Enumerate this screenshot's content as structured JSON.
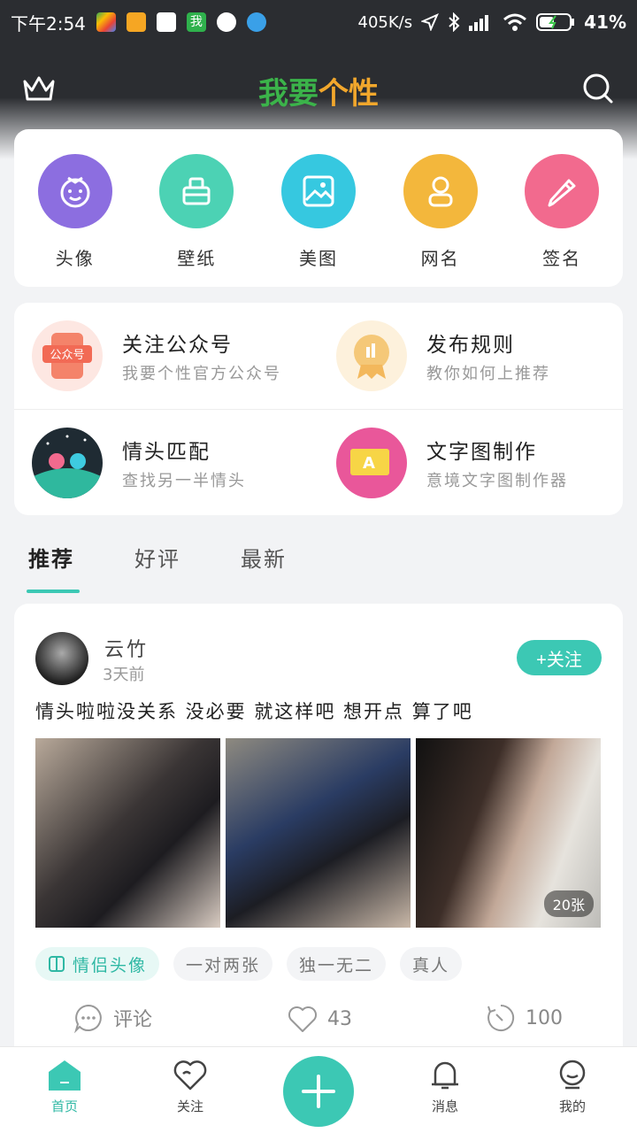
{
  "status": {
    "time": "下午2:54",
    "speed": "405K/s",
    "battery": "41%",
    "app_icon_badge": "我"
  },
  "header": {
    "title_part1": "我要",
    "title_part2": "个性"
  },
  "categories": [
    {
      "label": "头像",
      "color": "#8c6ee0",
      "icon": "baby-face-icon"
    },
    {
      "label": "壁纸",
      "color": "#4cd2b4",
      "icon": "wallpaper-icon"
    },
    {
      "label": "美图",
      "color": "#36c8e0",
      "icon": "image-icon"
    },
    {
      "label": "网名",
      "color": "#f3b73c",
      "icon": "user-icon"
    },
    {
      "label": "签名",
      "color": "#f26a8e",
      "icon": "pencil-icon"
    }
  ],
  "features": [
    {
      "title": "关注公众号",
      "subtitle": "我要个性官方公众号",
      "icon_text": "公众号"
    },
    {
      "title": "发布规则",
      "subtitle": "教你如何上推荐"
    },
    {
      "title": "情头匹配",
      "subtitle": "查找另一半情头"
    },
    {
      "title": "文字图制作",
      "subtitle": "意境文字图制作器",
      "icon_text": "A"
    }
  ],
  "tabs": [
    {
      "label": "推荐"
    },
    {
      "label": "好评"
    },
    {
      "label": "最新"
    }
  ],
  "post": {
    "user": "云竹",
    "time": "3天前",
    "follow_label": "+关注",
    "text": "情头啦啦没关系 没必要 就这样吧 想开点 算了吧",
    "photo_count": "20张",
    "tags": [
      "情侣头像",
      "一对两张",
      "独一无二",
      "真人"
    ],
    "comment_label": "评论",
    "likes": "43",
    "shares": "100"
  },
  "nav": [
    {
      "label": "首页"
    },
    {
      "label": "关注"
    },
    {
      "label": "消息"
    },
    {
      "label": "我的"
    }
  ],
  "colors": {
    "accent": "#3cc8b4"
  }
}
